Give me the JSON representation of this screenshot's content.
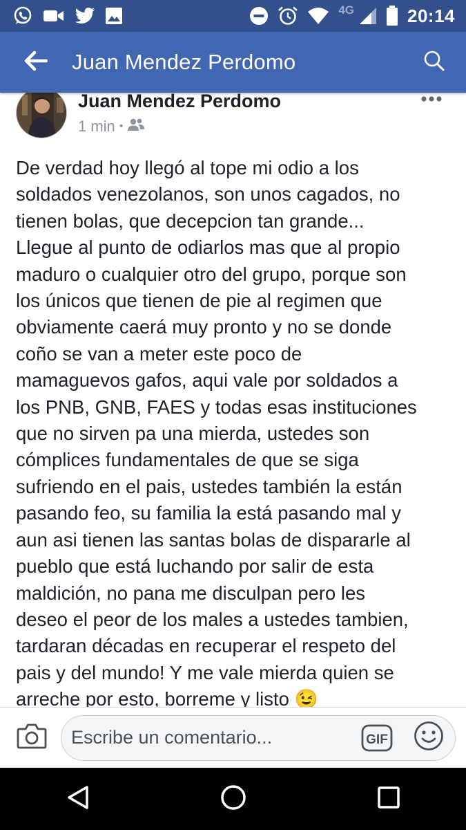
{
  "status_bar": {
    "left_icons": [
      "whatsapp-icon",
      "video-camera-icon",
      "twitter-icon",
      "image-icon"
    ],
    "right_icons": [
      "do-not-disturb-icon",
      "alarm-icon",
      "wifi-icon",
      "signal-icon",
      "battery-icon"
    ],
    "network": "4G",
    "time": "20:14"
  },
  "app_bar": {
    "title": "Juan Mendez Perdomo",
    "back_icon": "arrow-back-icon",
    "search_icon": "search-icon",
    "background_color": "#4267b2"
  },
  "post": {
    "author": "Juan Mendez Perdomo",
    "time": "1 min",
    "audience_icon": "friends-icon",
    "more_icon": "more-horizontal-icon",
    "text": "De verdad hoy llegó al tope mi odio a los\nsoldados venezolanos, son unos cagados, no\ntienen bolas, que decepcion tan grande...\nLlegue al punto de odiarlos mas que al propio\nmaduro o cualquier otro del grupo, porque son\nlos únicos que tienen de pie al regimen que\nobviamente caerá muy pronto y no se donde\ncoño se van a meter este poco de\nmamaguevos gafos, aqui vale por soldados a\nlos PNB, GNB, FAES y todas esas instituciones\nque no sirven pa una mierda, ustedes son\ncómplices fundamentales de que se siga\nsufriendo en el pais, ustedes también la están\npasando feo, su familia la está pasando mal y\naun asi tienen las santas bolas de dispararle al\npueblo que está luchando por salir de esta\nmaldición, no pana me disculpan pero les\ndeseo el peor de los males a ustedes tambien,\ntardaran décadas en recuperar el respeto del\npais y del mundo! Y me vale mierda quien se\narreche por esto, borreme y listo 😉"
  },
  "comment_bar": {
    "placeholder": "Escribe un comentario...",
    "camera_icon": "camera-icon",
    "gif_label": "GIF",
    "emoji_icon": "emoji-icon"
  },
  "nav_bar": {
    "buttons": [
      "back-triangle-icon",
      "home-circle-icon",
      "recents-square-icon"
    ]
  }
}
